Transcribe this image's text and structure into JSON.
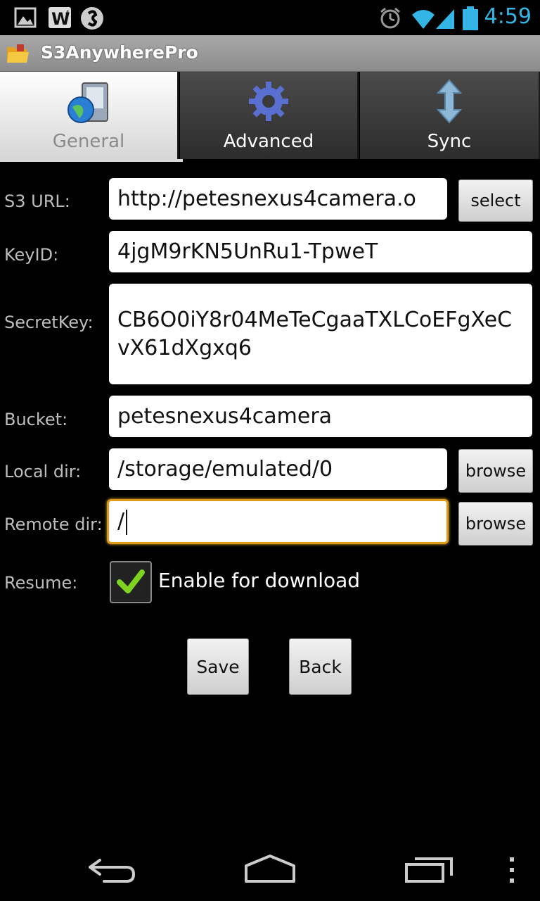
{
  "status_bar": {
    "time": "4:59",
    "icons": [
      "gallery-icon",
      "w4-icon",
      "shazam-icon",
      "alarm-icon",
      "wifi-icon",
      "signal-icon",
      "battery-icon"
    ],
    "accent_color": "#33b5e5"
  },
  "app": {
    "title": "S3AnywherePro"
  },
  "tabs": [
    {
      "label": "General",
      "icon": "server-globe-icon",
      "active": true
    },
    {
      "label": "Advanced",
      "icon": "gear-icon",
      "active": false
    },
    {
      "label": "Sync",
      "icon": "sync-arrows-icon",
      "active": false
    }
  ],
  "form": {
    "s3_url": {
      "label": "S3 URL:",
      "value": "http://petesnexus4camera.o",
      "button": "select"
    },
    "key_id": {
      "label": "KeyID:",
      "value": "4jgM9rKN5UnRu1-TpweT"
    },
    "secret_key": {
      "label": "SecretKey:",
      "value": "CB6O0iY8r04MeTeCgaaTXLCoEFgXeCvX61dXgxq6"
    },
    "bucket": {
      "label": "Bucket:",
      "value": "petesnexus4camera"
    },
    "local_dir": {
      "label": "Local dir:",
      "value": "/storage/emulated/0",
      "button": "browse"
    },
    "remote_dir": {
      "label": "Remote dir:",
      "value": "/",
      "button": "browse"
    },
    "resume": {
      "label": "Resume:",
      "checkbox_label": "Enable for download",
      "checked": true
    }
  },
  "actions": {
    "save": "Save",
    "back": "Back"
  },
  "nav_bar": {
    "icons": [
      "back-icon",
      "home-icon",
      "recents-icon",
      "menu-icon"
    ]
  }
}
